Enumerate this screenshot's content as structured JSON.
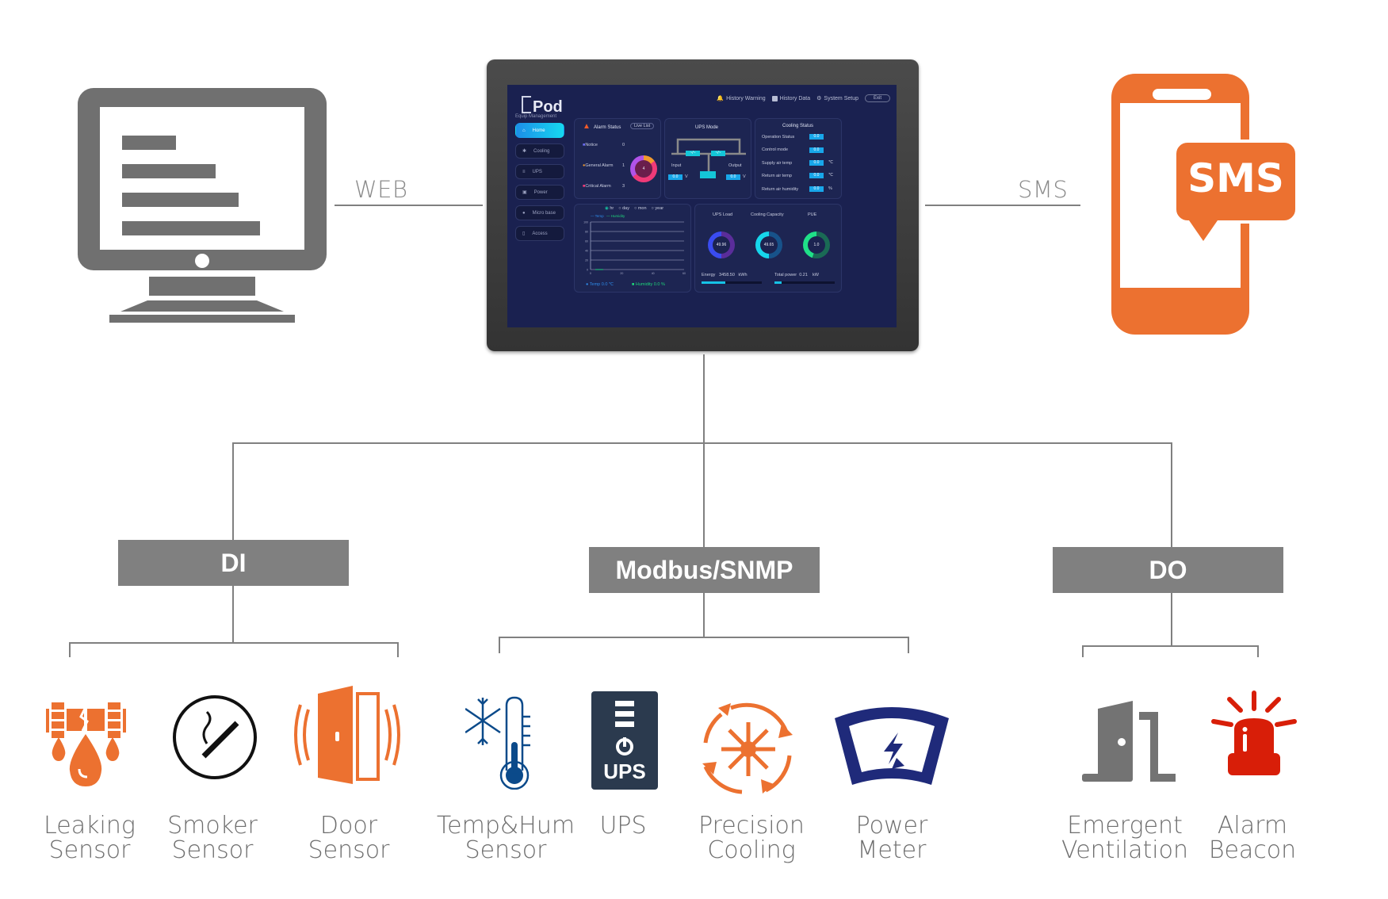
{
  "connections": {
    "web_label": "WEB",
    "sms_label": "SMS"
  },
  "sms_bubble_text": "SMS",
  "protocols": [
    {
      "label": "DI"
    },
    {
      "label": "Modbus/SNMP"
    },
    {
      "label": "DO"
    }
  ],
  "devices": {
    "di": [
      {
        "line1": "Leaking",
        "line2": "Sensor",
        "icon": "leak-sensor-icon"
      },
      {
        "line1": "Smoker",
        "line2": "Sensor",
        "icon": "smoke-sensor-icon"
      },
      {
        "line1": "Door",
        "line2": "Sensor",
        "icon": "door-sensor-icon"
      }
    ],
    "modbus": [
      {
        "line1": "Temp&Hum",
        "line2": "Sensor",
        "icon": "thermometer-snowflake-icon"
      },
      {
        "line1": "UPS",
        "line2": "",
        "icon": "ups-icon"
      },
      {
        "line1": "Precision",
        "line2": "Cooling",
        "icon": "precision-cooling-icon"
      },
      {
        "line1": "Power",
        "line2": "Meter",
        "icon": "power-meter-icon"
      }
    ],
    "do": [
      {
        "line1": "Emergent",
        "line2": "Ventilation",
        "icon": "ventilation-door-icon"
      },
      {
        "line1": "Alarm",
        "line2": "Beacon",
        "icon": "alarm-beacon-icon"
      }
    ]
  },
  "colors": {
    "orange": "#ec7130",
    "gray": "#808080",
    "navy": "#1a2150",
    "ups_dark": "#2b3a4e",
    "meter_blue": "#1f2a7a",
    "beacon_red": "#d81e08",
    "thermo_blue": "#0b4a8a"
  },
  "dashboard": {
    "logo": "Pod",
    "nav": {
      "history_warning": "History Warning",
      "history_data": "History Data",
      "system_setup": "System Setup",
      "exit": "Exit"
    },
    "sidebar_title": "Equip Management",
    "sidebar": [
      {
        "label": "Home",
        "active": true
      },
      {
        "label": "Cooling"
      },
      {
        "label": "UPS"
      },
      {
        "label": "Power"
      },
      {
        "label": "Micro base"
      },
      {
        "label": "Access"
      }
    ],
    "alarm": {
      "title": "Alarm Status",
      "live_list": "Live List",
      "items": [
        {
          "label": "Notice",
          "value": "0"
        },
        {
          "label": "General Alarm",
          "value": "1"
        },
        {
          "label": "Critical Alarm",
          "value": "3"
        }
      ],
      "total": "4"
    },
    "ups_mode": {
      "title": "UPS Mode",
      "switch_a": "~/~",
      "switch_b": "~/~",
      "input_label": "Input",
      "output_label": "Output",
      "input_value": "0.0",
      "output_value": "0.0",
      "unit": "V"
    },
    "cooling": {
      "title": "Cooling Status",
      "rows": [
        {
          "label": "Operation Status",
          "value": "0.0",
          "unit": ""
        },
        {
          "label": "Control mode",
          "value": "0.0",
          "unit": ""
        },
        {
          "label": "Supply air temp",
          "value": "0.0",
          "unit": "℃"
        },
        {
          "label": "Return air temp",
          "value": "0.0",
          "unit": "℃"
        },
        {
          "label": "Return air humidity",
          "value": "0.0",
          "unit": "%"
        }
      ]
    },
    "trend": {
      "ranges": [
        "hr",
        "day",
        "mon",
        "year"
      ],
      "selected": "hr",
      "legend": [
        "Temp",
        "Humidity"
      ],
      "y_ticks": [
        "100",
        "80",
        "60",
        "40",
        "20",
        "0"
      ],
      "x_ticks": [
        "0",
        "20",
        "40",
        "60"
      ],
      "temp_label": "Temp",
      "temp_value": "0.0 ℃",
      "hum_label": "Humidity",
      "hum_value": "0.0 %"
    },
    "gauges": [
      {
        "title": "UPS Load",
        "value": "49.96",
        "fraction": 0.5
      },
      {
        "title": "Cooling Capacity",
        "value": "49.65",
        "fraction": 0.5
      },
      {
        "title": "PUE",
        "value": "1.0",
        "fraction": 0.55
      }
    ],
    "energy": {
      "label": "Energy",
      "value": "3458.50",
      "unit": "kWh",
      "fraction": 0.4
    },
    "total_power": {
      "label": "Total power",
      "value": "0.21",
      "unit": "kW",
      "fraction": 0.12
    }
  }
}
